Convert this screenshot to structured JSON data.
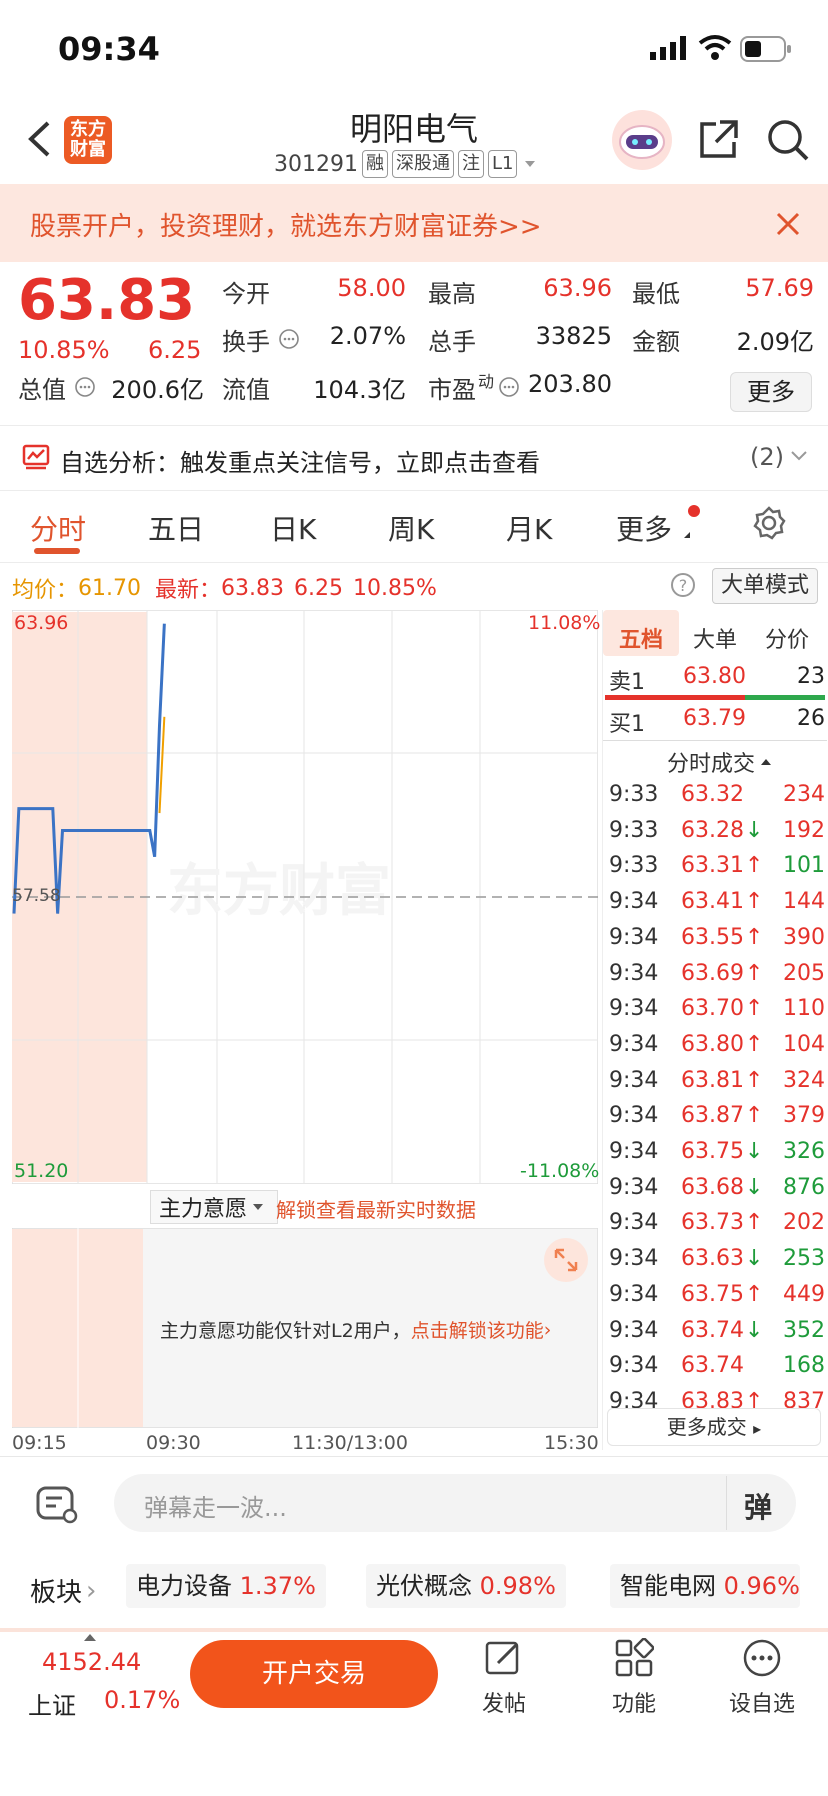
{
  "status_bar": {
    "time": "09:34"
  },
  "header": {
    "logo_text_1": "东方",
    "logo_text_2": "财富",
    "stock_name": "明阳电气",
    "stock_code": "301291",
    "tags": [
      "融",
      "深股通",
      "注",
      "L1"
    ]
  },
  "banner": {
    "text": "股票开户，投资理财，就选东方财富证券>>"
  },
  "quote": {
    "price": "63.83",
    "change_pct": "10.85%",
    "change": "6.25",
    "fields": [
      {
        "label": "今开",
        "value": "58.00",
        "color": "#e5322b"
      },
      {
        "label": "最高",
        "value": "63.96",
        "color": "#e5322b"
      },
      {
        "label": "最低",
        "value": "57.69",
        "color": "#e5322b"
      },
      {
        "label": "换手",
        "value": "2.07%",
        "color": "#222"
      },
      {
        "label": "总手",
        "value": "33825",
        "color": "#222"
      },
      {
        "label": "金额",
        "value": "2.09亿",
        "color": "#222"
      },
      {
        "label": "总值",
        "value": "200.6亿",
        "color": "#222"
      },
      {
        "label": "流值",
        "value": "104.3亿",
        "color": "#222"
      },
      {
        "label": "市盈",
        "value": "203.80",
        "color": "#222"
      }
    ],
    "pe_superscript": "动",
    "more_label": "更多"
  },
  "signal": {
    "text": "自选分析：触发重点关注信号，立即点击查看",
    "count": "(2)"
  },
  "tabs": [
    "分时",
    "五日",
    "日K",
    "周K",
    "月K",
    "更多"
  ],
  "info_line": {
    "avg_label": "均价：",
    "avg_value": "61.70",
    "latest_label": "最新：",
    "latest_value": "63.83",
    "latest_change": "6.25",
    "latest_pct": "10.85%",
    "big_order_label": "大单模式"
  },
  "chart_data": {
    "type": "line",
    "y_labels_left": [
      "63.96",
      "57.58",
      "51.20"
    ],
    "y_labels_right": [
      "11.08%",
      "-11.08%"
    ],
    "x_labels": [
      "09:15",
      "09:30",
      "11:30/13:00",
      "15:30"
    ],
    "watermark": "东方财富",
    "ylim": [
      51.2,
      63.96
    ],
    "base": 57.58,
    "price_series": [
      {
        "t": 0,
        "y": 57.2
      },
      {
        "t": 1,
        "y": 59.6
      },
      {
        "t": 8,
        "y": 59.6
      },
      {
        "t": 9,
        "y": 57.2
      },
      {
        "t": 10,
        "y": 59.1
      },
      {
        "t": 28,
        "y": 59.1
      },
      {
        "t": 29,
        "y": 58.5
      },
      {
        "t": 30,
        "y": 61.5
      },
      {
        "t": 31,
        "y": 63.83
      }
    ],
    "avg_series": [
      {
        "t": 30,
        "y": 59.5
      },
      {
        "t": 31,
        "y": 61.7
      }
    ],
    "total_t": 120
  },
  "sub_chart": {
    "selector_label": "主力意愿",
    "unlock_text": "解锁查看最新实时数据",
    "notice": "主力意愿功能仅针对L2用户，",
    "notice_link": "点击解锁该功能"
  },
  "panel": {
    "tabs": [
      "五档",
      "大单",
      "分价"
    ],
    "ask": {
      "label": "卖1",
      "price": "63.80",
      "vol": "23"
    },
    "bid": {
      "label": "买1",
      "price": "63.79",
      "vol": "26"
    },
    "trades_header": "分时成交",
    "trades": [
      {
        "t": "9:33",
        "p": "63.32",
        "d": "",
        "v": "234",
        "vc": "#e5322b"
      },
      {
        "t": "9:33",
        "p": "63.28",
        "d": "↓",
        "v": "192",
        "vc": "#e5322b"
      },
      {
        "t": "9:33",
        "p": "63.31",
        "d": "↑",
        "v": "101",
        "vc": "#1e9b3a"
      },
      {
        "t": "9:34",
        "p": "63.41",
        "d": "↑",
        "v": "144",
        "vc": "#e5322b"
      },
      {
        "t": "9:34",
        "p": "63.55",
        "d": "↑",
        "v": "390",
        "vc": "#e5322b"
      },
      {
        "t": "9:34",
        "p": "63.69",
        "d": "↑",
        "v": "205",
        "vc": "#e5322b"
      },
      {
        "t": "9:34",
        "p": "63.70",
        "d": "↑",
        "v": "110",
        "vc": "#e5322b"
      },
      {
        "t": "9:34",
        "p": "63.80",
        "d": "↑",
        "v": "104",
        "vc": "#e5322b"
      },
      {
        "t": "9:34",
        "p": "63.81",
        "d": "↑",
        "v": "324",
        "vc": "#e5322b"
      },
      {
        "t": "9:34",
        "p": "63.87",
        "d": "↑",
        "v": "379",
        "vc": "#e5322b"
      },
      {
        "t": "9:34",
        "p": "63.75",
        "d": "↓",
        "v": "326",
        "vc": "#1e9b3a"
      },
      {
        "t": "9:34",
        "p": "63.68",
        "d": "↓",
        "v": "876",
        "vc": "#1e9b3a"
      },
      {
        "t": "9:34",
        "p": "63.73",
        "d": "↑",
        "v": "202",
        "vc": "#e5322b"
      },
      {
        "t": "9:34",
        "p": "63.63",
        "d": "↓",
        "v": "253",
        "vc": "#1e9b3a"
      },
      {
        "t": "9:34",
        "p": "63.75",
        "d": "↑",
        "v": "449",
        "vc": "#e5322b"
      },
      {
        "t": "9:34",
        "p": "63.74",
        "d": "↓",
        "v": "352",
        "vc": "#1e9b3a"
      },
      {
        "t": "9:34",
        "p": "63.74",
        "d": "",
        "v": "168",
        "vc": "#1e9b3a"
      },
      {
        "t": "9:34",
        "p": "63.83",
        "d": "↑",
        "v": "837",
        "vc": "#e5322b"
      }
    ],
    "more_trades": "更多成交"
  },
  "comment": {
    "placeholder": "弹幕走一波...",
    "danmu_label": "弹"
  },
  "sectors": {
    "label": "板块",
    "items": [
      {
        "name": "电力设备",
        "pct": "1.37%"
      },
      {
        "name": "光伏概念",
        "pct": "0.98%"
      },
      {
        "name": "智能电网",
        "pct": "0.96%"
      }
    ]
  },
  "bottom": {
    "index_value": "4152.44",
    "index_name": "上证",
    "index_pct": "0.17%",
    "open_trade": "开户交易",
    "actions": [
      "发帖",
      "功能",
      "设自选"
    ]
  }
}
